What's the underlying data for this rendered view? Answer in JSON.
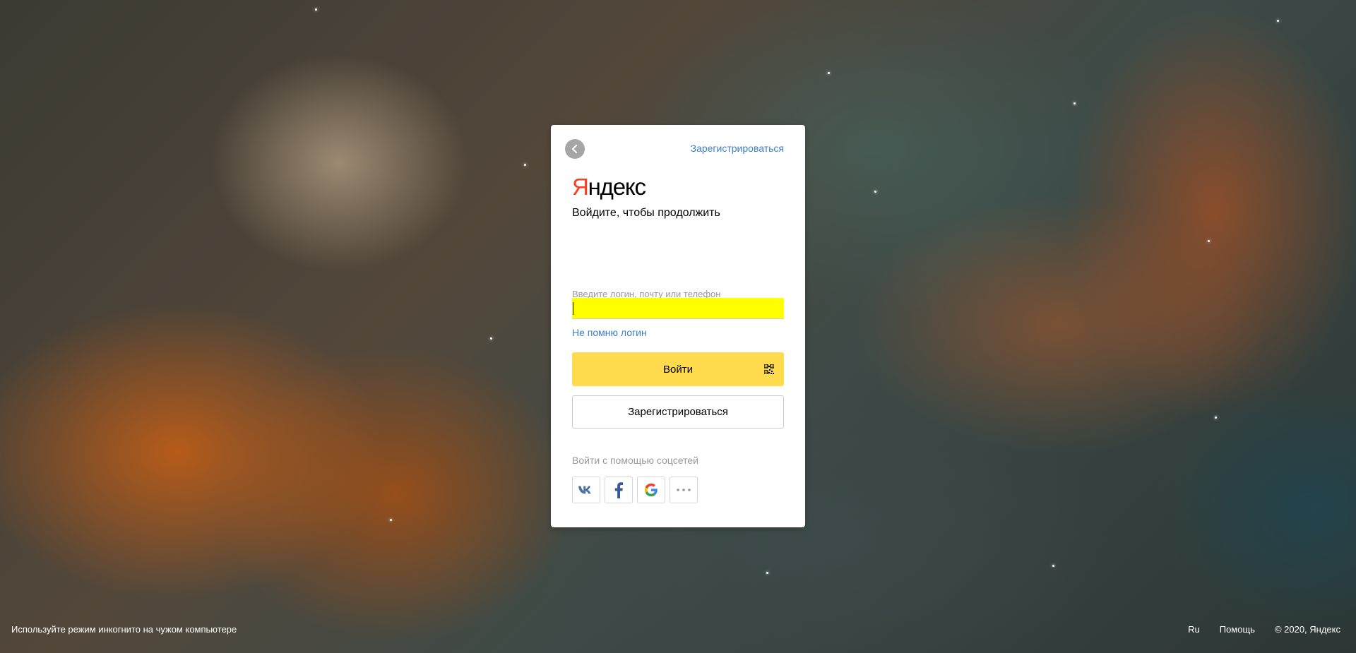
{
  "card": {
    "back_icon": "chevron-left-icon",
    "register_link": "Зарегистрироваться",
    "logo": {
      "first_letter": "Я",
      "rest": "ндекс",
      "first_letter_color": "#fc3f1d"
    },
    "subtitle": "Войдите, чтобы продолжить",
    "login_field": {
      "label": "Введите логин, почту или телефон",
      "value": "",
      "highlight_color": "#ffff00"
    },
    "forgot_link": "Не помню логин",
    "login_button": {
      "label": "Войти",
      "icon": "qr-code-icon",
      "color": "#ffdb4d"
    },
    "register_button": "Зарегистрироваться",
    "social": {
      "label": "Войти с помощью соцсетей",
      "buttons": [
        "vk-icon",
        "facebook-icon",
        "google-icon",
        "more-icon"
      ]
    }
  },
  "footer": {
    "incognito_hint": "Используйте режим инкогнито на чужом компьютере",
    "language": "Ru",
    "help": "Помощь",
    "copyright": "© 2020, Яндекс"
  },
  "colors": {
    "link": "#3d7fc9",
    "muted": "#999999"
  }
}
